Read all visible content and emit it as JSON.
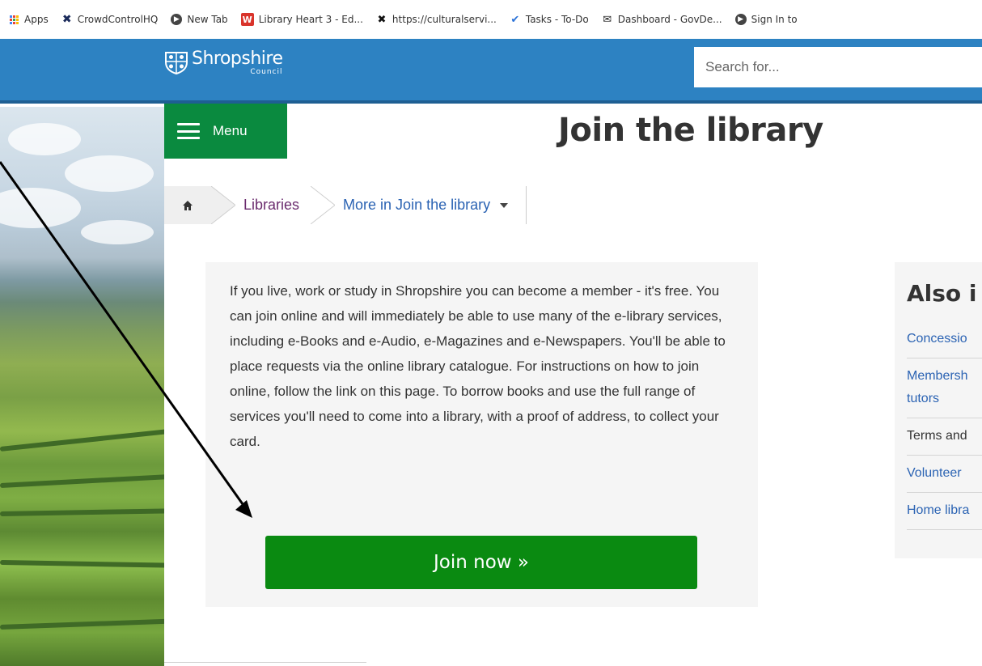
{
  "bookmarks": [
    {
      "label": "Apps",
      "icon": "apps-grid-icon"
    },
    {
      "label": "CrowdControlHQ",
      "icon": "crowdcontrol-icon"
    },
    {
      "label": "New Tab",
      "icon": "globe-icon"
    },
    {
      "label": "Library Heart 3 - Ed...",
      "icon": "w-icon"
    },
    {
      "label": "https://culturalservi...",
      "icon": "x-icon"
    },
    {
      "label": "Tasks - To-Do",
      "icon": "check-icon"
    },
    {
      "label": "Dashboard - GovDe...",
      "icon": "chat-icon"
    },
    {
      "label": "Sign In to",
      "icon": "globe-icon"
    }
  ],
  "header": {
    "logo_name": "Shropshire",
    "logo_sub": "Council",
    "search_placeholder": "Search for...",
    "background": "#2d82c2"
  },
  "menu": {
    "label": "Menu",
    "color": "#0a8a3f"
  },
  "page": {
    "title": "Join the library"
  },
  "breadcrumb": {
    "items": [
      {
        "label": "Libraries"
      },
      {
        "label": "More in Join the library"
      }
    ]
  },
  "content": {
    "body": "If you live, work or study in Shropshire you can become a member - it's free. You can join online and will immediately be able to use many of the e-library services, including e-Books and e-Audio, e-Magazines and e-Newspapers. You'll be able to place requests via the online library catalogue. For instructions on how to join online, follow the link on this page. To borrow books and use the full range of services you'll need to come into a library, with a proof of address, to collect your card.",
    "join_button": "Join now »",
    "join_color": "#0a8a11"
  },
  "sidebar": {
    "title": "Also i",
    "items": [
      {
        "label": "Concessio",
        "link": true
      },
      {
        "label": "Membersh tutors",
        "link": true
      },
      {
        "label": "Terms and",
        "link": false
      },
      {
        "label": "Volunteer",
        "link": true
      },
      {
        "label": "Home libra",
        "link": true
      }
    ]
  }
}
